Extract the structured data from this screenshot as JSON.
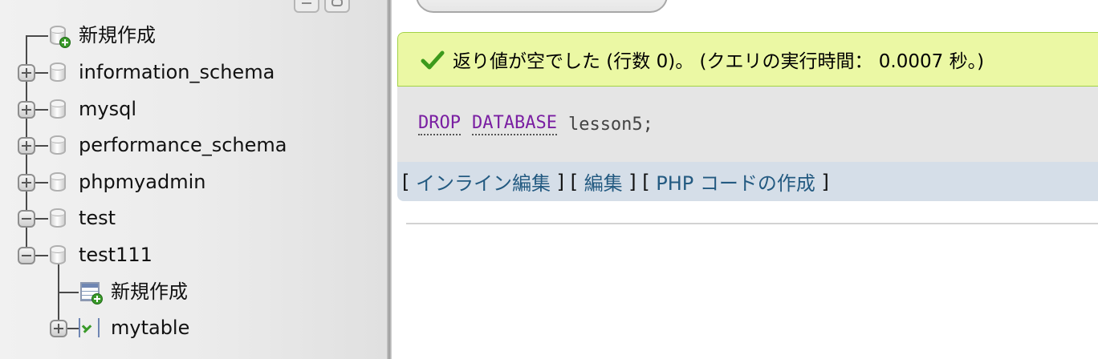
{
  "nav": {
    "new_label": "新規作成",
    "databases": [
      {
        "name": "information_schema",
        "expanded": false
      },
      {
        "name": "mysql",
        "expanded": false
      },
      {
        "name": "performance_schema",
        "expanded": false
      },
      {
        "name": "phpmyadmin",
        "expanded": false
      },
      {
        "name": "test",
        "expanded": true
      },
      {
        "name": "test111",
        "expanded": true
      }
    ],
    "test111_children": {
      "new_table_label": "新規作成",
      "tables": [
        "mytable"
      ]
    }
  },
  "result": {
    "message": "返り値が空でした (行数 0)。 (クエリの実行時間： 0.0007 秒。)",
    "query": {
      "keyword1": "DROP",
      "keyword2": "DATABASE",
      "identifier": "lesson5;"
    },
    "links": {
      "inline_edit": "インライン編集",
      "edit": "編集",
      "create_php": "PHP コードの作成"
    }
  },
  "colors": {
    "success_bg": "#ebf8a4",
    "success_border": "#a2d246",
    "sql_keyword": "#7a1fa2",
    "link": "#235a81"
  }
}
